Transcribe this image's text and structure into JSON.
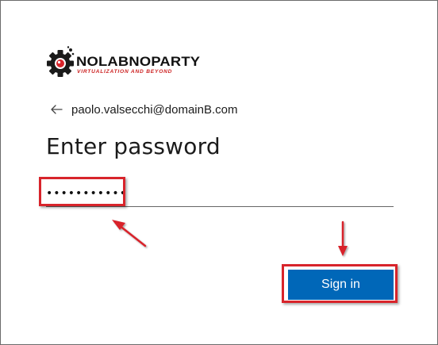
{
  "logo": {
    "title": "NOLABNOPARTY",
    "tagline": "VIRTUALIZATION AND BEYOND",
    "icon": "gear-icon"
  },
  "identity": {
    "back_icon": "back-arrow-icon",
    "email": "paolo.valsecchi@domainB.com"
  },
  "heading": "Enter password",
  "password_field": {
    "value": "•••••••••••",
    "type": "password"
  },
  "sign_in_button": {
    "label": "Sign in"
  },
  "colors": {
    "button_blue": "#0067b8",
    "annotation_red": "#d8242b",
    "logo_red": "#cc1f1f"
  }
}
